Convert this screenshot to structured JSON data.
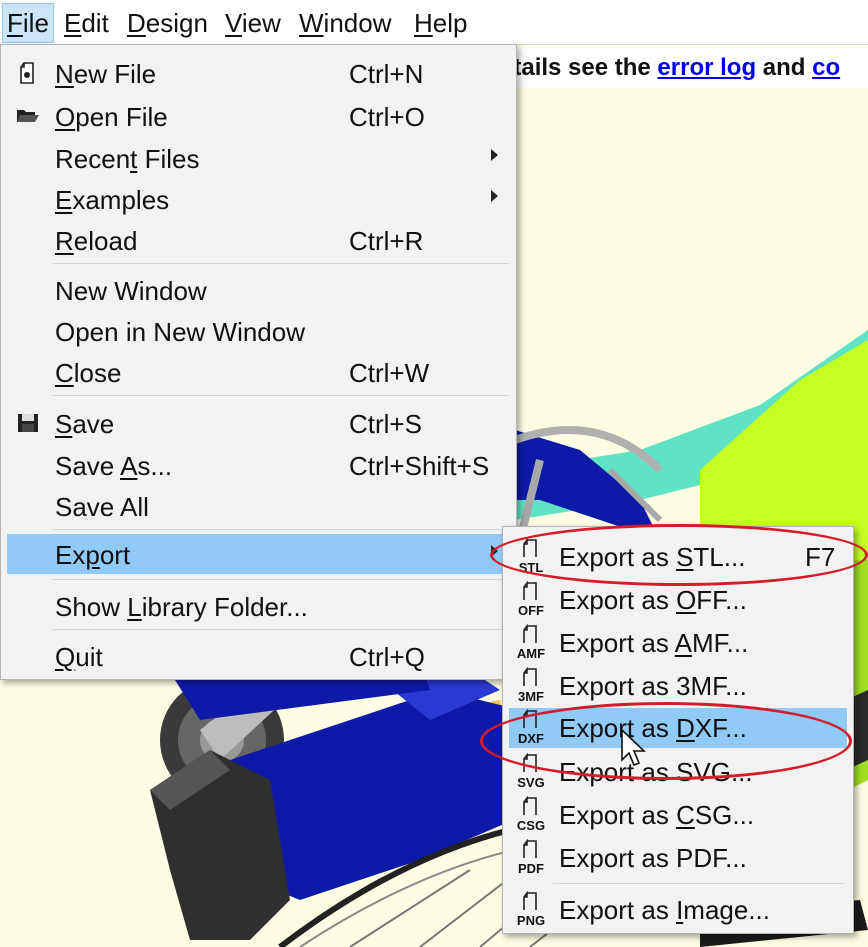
{
  "menubar": {
    "items": [
      {
        "label": "File",
        "mnemonic": "F",
        "rest": "ile"
      },
      {
        "label": "Edit",
        "mnemonic": "E",
        "rest": "dit"
      },
      {
        "label": "Design",
        "mnemonic": "D",
        "rest": "esign"
      },
      {
        "label": "View",
        "mnemonic": "V",
        "rest": "iew"
      },
      {
        "label": "Window",
        "mnemonic": "W",
        "rest": "indow"
      },
      {
        "label": "Help",
        "mnemonic": "H",
        "rest": "elp"
      }
    ]
  },
  "error_bar": {
    "prefix": "etails see the ",
    "link1": "error log",
    "middle": " and ",
    "link2": "co"
  },
  "file_menu": {
    "items": [
      {
        "pre": "",
        "u": "N",
        "post": "ew File",
        "shortcut": "Ctrl+N",
        "icon": "new-file-icon"
      },
      {
        "pre": "",
        "u": "O",
        "post": "pen File",
        "shortcut": "Ctrl+O",
        "icon": "open-folder-icon"
      },
      {
        "pre": "Recen",
        "u": "t",
        "post": " Files",
        "shortcut": ""
      },
      {
        "pre": "",
        "u": "E",
        "post": "xamples",
        "shortcut": ""
      },
      {
        "pre": "",
        "u": "R",
        "post": "eload",
        "shortcut": "Ctrl+R"
      },
      {
        "pre": "New Window",
        "u": "",
        "post": "",
        "shortcut": ""
      },
      {
        "pre": "Open in New Window",
        "u": "",
        "post": "",
        "shortcut": ""
      },
      {
        "pre": "",
        "u": "C",
        "post": "lose",
        "shortcut": "Ctrl+W"
      },
      {
        "pre": "",
        "u": "S",
        "post": "ave",
        "shortcut": "Ctrl+S",
        "icon": "save-disk-icon"
      },
      {
        "pre": "Save ",
        "u": "A",
        "post": "s...",
        "shortcut": "Ctrl+Shift+S"
      },
      {
        "pre": "Save All",
        "u": "",
        "post": "",
        "shortcut": ""
      },
      {
        "pre": "Ex",
        "u": "p",
        "post": "ort",
        "shortcut": ""
      },
      {
        "pre": "Show ",
        "u": "L",
        "post": "ibrary Folder...",
        "shortcut": ""
      },
      {
        "pre": "",
        "u": "Q",
        "post": "uit",
        "shortcut": "Ctrl+Q"
      }
    ]
  },
  "export_menu": {
    "items": [
      {
        "pre": "Export as ",
        "u": "S",
        "post": "TL...",
        "shortcut": "F7",
        "badge": "STL"
      },
      {
        "pre": "Export as ",
        "u": "O",
        "post": "FF...",
        "shortcut": "",
        "badge": "OFF"
      },
      {
        "pre": "Export as ",
        "u": "A",
        "post": "MF...",
        "shortcut": "",
        "badge": "AMF"
      },
      {
        "pre": "Export as 3MF...",
        "u": "",
        "post": "",
        "shortcut": "",
        "badge": "3MF"
      },
      {
        "pre": "Export as ",
        "u": "D",
        "post": "XF...",
        "shortcut": "",
        "badge": "DXF"
      },
      {
        "pre": "Export as SVG...",
        "u": "",
        "post": "",
        "shortcut": "",
        "badge": "SVG"
      },
      {
        "pre": "Export as ",
        "u": "C",
        "post": "SG...",
        "shortcut": "",
        "badge": "CSG"
      },
      {
        "pre": "Export as PDF...",
        "u": "",
        "post": "",
        "shortcut": "",
        "badge": "PDF"
      },
      {
        "pre": "Export as ",
        "u": "I",
        "post": "mage...",
        "shortcut": "",
        "badge": "PNG"
      }
    ]
  },
  "colors": {
    "highlight": "#91c9f7",
    "annotation": "#d41c2c",
    "viewport_bg": "#fdfde3"
  }
}
